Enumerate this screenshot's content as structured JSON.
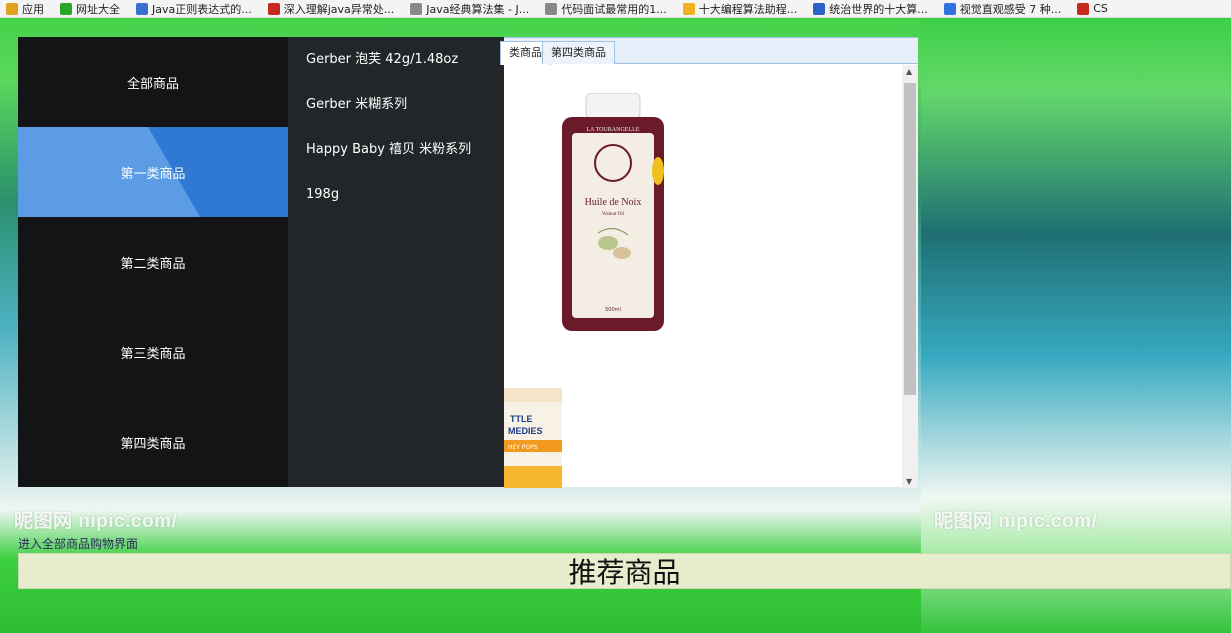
{
  "bookmarks": [
    {
      "label": "应用",
      "icon": "apps-grid-icon",
      "color": "#e0a020"
    },
    {
      "label": "网址大全",
      "icon": "plus-circle-icon",
      "color": "#2aa72a"
    },
    {
      "label": "Java正则表达式的...",
      "icon": "blog-icon",
      "color": "#3a6fd0"
    },
    {
      "label": "深入理解java异常处...",
      "icon": "csdn-icon",
      "color": "#c8281e"
    },
    {
      "label": "Java经典算法集 - J...",
      "icon": "page-icon",
      "color": "#888888"
    },
    {
      "label": "代码面试最常用的1...",
      "icon": "page-icon",
      "color": "#888888"
    },
    {
      "label": "十大编程算法助程...",
      "icon": "bulb-icon",
      "color": "#f0b020"
    },
    {
      "label": "统治世界的十大算...",
      "icon": "kr-icon",
      "color": "#2a62c8"
    },
    {
      "label": "视觉直观感受 7 种...",
      "icon": "b-icon",
      "color": "#3070e0"
    },
    {
      "label": "CS",
      "icon": "csdn-icon",
      "color": "#c8281e"
    }
  ],
  "categories": [
    {
      "label": "全部商品"
    },
    {
      "label": "第一类商品"
    },
    {
      "label": "第二类商品"
    },
    {
      "label": "第三类商品"
    },
    {
      "label": "第四类商品"
    }
  ],
  "sub_items": [
    {
      "label": "Gerber 泡芙 42g/1.48oz"
    },
    {
      "label": "Gerber 米糊系列"
    },
    {
      "label": "Happy Baby 禧贝 米粉系列"
    },
    {
      "label": "198g"
    }
  ],
  "tabs": [
    {
      "label": "类商品"
    },
    {
      "label": "第四类商品"
    }
  ],
  "product": {
    "brand": "LA TOURANGELLE",
    "name": "Huile de Noix",
    "sub": "Walnut Oil",
    "volume": "500ml",
    "box_text1": "TTLE",
    "box_text2": "MEDIES",
    "box_text3": "HEY POPS"
  },
  "watermark": "昵图网 nipic.com/",
  "link_text": "进入全部商品购物界面",
  "recommend_title": "推荐商品",
  "colors": {
    "active_cat": "#5c9ce5",
    "active_cat_accent": "#2f78d3",
    "menu_bg": "#131416",
    "submenu_bg": "#222628"
  }
}
